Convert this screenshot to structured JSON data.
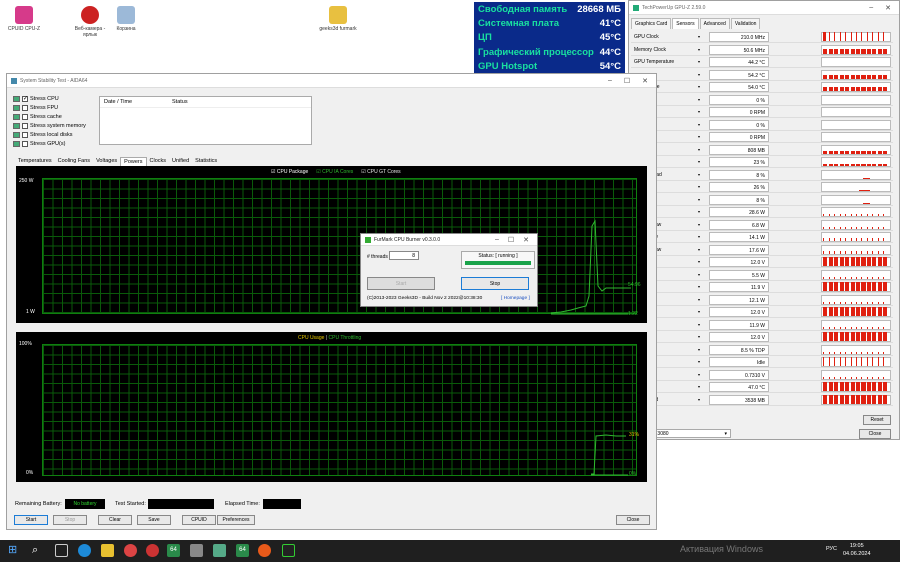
{
  "desktop": {
    "icons": [
      "CPUID CPU-Z",
      "Веб-камера - ярлык",
      "Корзина",
      "geeks3d furmark"
    ]
  },
  "osd": [
    {
      "label": "Свободная память",
      "value": "28668 МБ"
    },
    {
      "label": "Системная плата",
      "value": "41°C"
    },
    {
      "label": "ЦП",
      "value": "45°C"
    },
    {
      "label": "Графический процессор",
      "value": "44°C"
    },
    {
      "label": "GPU Hotspot",
      "value": "54°C"
    }
  ],
  "gpuz": {
    "title": "TechPowerUp GPU-Z 2.59.0",
    "tabs": [
      "Graphics Card",
      "Sensors",
      "Advanced",
      "Validation"
    ],
    "sensors": [
      {
        "label": "GPU Clock",
        "value": "210.0 MHz"
      },
      {
        "label": "Memory Clock",
        "value": "50.6 MHz"
      },
      {
        "label": "GPU Temperature",
        "value": "44.2 °C"
      },
      {
        "label": "",
        "value": "54.2 °C"
      },
      {
        "label": "emperature",
        "value": "54.0 °C"
      },
      {
        "label": "ed (%)",
        "value": "0 %"
      },
      {
        "label": "ed (RPM)",
        "value": "0 RPM"
      },
      {
        "label": "ed (%)",
        "value": "0 %"
      },
      {
        "label": "ed (RPM)",
        "value": "0 RPM"
      },
      {
        "label": "ed",
        "value": "808 MB"
      },
      {
        "label": "",
        "value": "23 %"
      },
      {
        "label": "ntroller Load",
        "value": "8 %"
      },
      {
        "label": "ine Load",
        "value": "26 %"
      },
      {
        "label": "Load",
        "value": "8 %"
      },
      {
        "label": "r Draw",
        "value": "28.6 W"
      },
      {
        "label": "Power Draw",
        "value": "6.8 W"
      },
      {
        "label": "ower Draw",
        "value": "14.1 W"
      },
      {
        "label": "Power Draw",
        "value": "17.6 W"
      },
      {
        "label": "Voltage",
        "value": "12.0 V"
      },
      {
        "label": "ower",
        "value": "5.5 W"
      },
      {
        "label": "oltage",
        "value": "11.9 V"
      },
      {
        "label": "ower",
        "value": "12.1 W"
      },
      {
        "label": "oltage",
        "value": "12.0 V"
      },
      {
        "label": "ower",
        "value": "11.9 W"
      },
      {
        "label": "oltage",
        "value": "12.0 V"
      },
      {
        "label": "mption (%",
        "value": "8.5 % TDP"
      },
      {
        "label": "ason",
        "value": "Idle"
      },
      {
        "label": "",
        "value": "0.7310 V"
      },
      {
        "label": "erature",
        "value": "47.0 °C"
      },
      {
        "label": "mory Used",
        "value": "3538 MB"
      }
    ],
    "gpu_name": "orce RTX 3080",
    "reset": "Reset",
    "close": "Close"
  },
  "aida": {
    "title": "System Stability Test - AIDA64",
    "stress": [
      {
        "label": "Stress CPU",
        "checked": true
      },
      {
        "label": "Stress FPU",
        "checked": false
      },
      {
        "label": "Stress cache",
        "checked": false
      },
      {
        "label": "Stress system memory",
        "checked": false
      },
      {
        "label": "Stress local disks",
        "checked": false
      },
      {
        "label": "Stress GPU(s)",
        "checked": false
      }
    ],
    "log_headers": [
      "Date / Time",
      "Status"
    ],
    "tabs": [
      "Temperatures",
      "Cooling Fans",
      "Voltages",
      "Powers",
      "Clocks",
      "Unified",
      "Statistics"
    ],
    "active_tab": "Powers",
    "graph1": {
      "legend": [
        "CPU Package",
        "CPU IA Cores",
        "CPU GT Cores"
      ],
      "ymax": "250 W",
      "ymin": "1 W",
      "v1": "54.96",
      "v2": "1.22"
    },
    "graph2": {
      "legend_a": "CPU Usage",
      "legend_sep": "|",
      "legend_b": "CPU Throttling",
      "ymax": "100%",
      "ymin": "0%",
      "v1": "31%",
      "v2": "0%"
    },
    "remaining_label": "Remaining Battery:",
    "battery": "No battery",
    "started_label": "Test Started:",
    "elapsed_label": "Elapsed Time:",
    "buttons": [
      "Start",
      "Stop",
      "Clear",
      "Save",
      "CPUID",
      "Preferences"
    ],
    "close": "Close"
  },
  "furmark": {
    "title": "FurMark CPU Burner v0.3.0.0",
    "threads_label": "# threads",
    "threads": "8",
    "status": "Status: [ running ]",
    "start": "Start",
    "stop": "Stop",
    "footer": "(C)2013-2023 Geeks3D - Build Nov 2 2022@10:38:30",
    "homepage": "[ Homepage ]"
  },
  "taskbar": {
    "lang": "РУС",
    "time": "19:05",
    "date": "04.06.2024",
    "watermark": "Активация Windows"
  },
  "colors": {
    "osd_bg": "#0a2a8a",
    "osd_label": "#19e0a0",
    "graph_line": "#2fb82f",
    "sensor_bar": "#e02010"
  }
}
